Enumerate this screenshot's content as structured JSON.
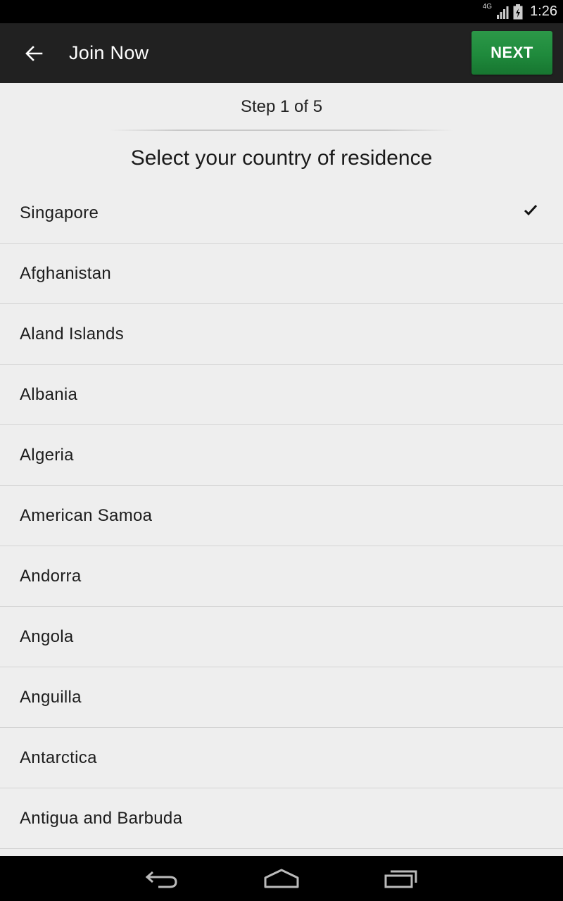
{
  "status_bar": {
    "network": "4G",
    "time": "1:26"
  },
  "action_bar": {
    "title": "Join Now",
    "next_label": "NEXT"
  },
  "form": {
    "step": "Step 1 of 5",
    "prompt": "Select your country of residence"
  },
  "countries": [
    {
      "label": "Singapore",
      "selected": true
    },
    {
      "label": "Afghanistan"
    },
    {
      "label": "Aland Islands"
    },
    {
      "label": "Albania"
    },
    {
      "label": "Algeria"
    },
    {
      "label": "American Samoa"
    },
    {
      "label": "Andorra"
    },
    {
      "label": "Angola"
    },
    {
      "label": "Anguilla"
    },
    {
      "label": "Antarctica"
    },
    {
      "label": "Antigua and Barbuda"
    }
  ],
  "colors": {
    "accent": "#1f8a3c",
    "action_bar": "#212121",
    "background": "#eeeeee"
  }
}
